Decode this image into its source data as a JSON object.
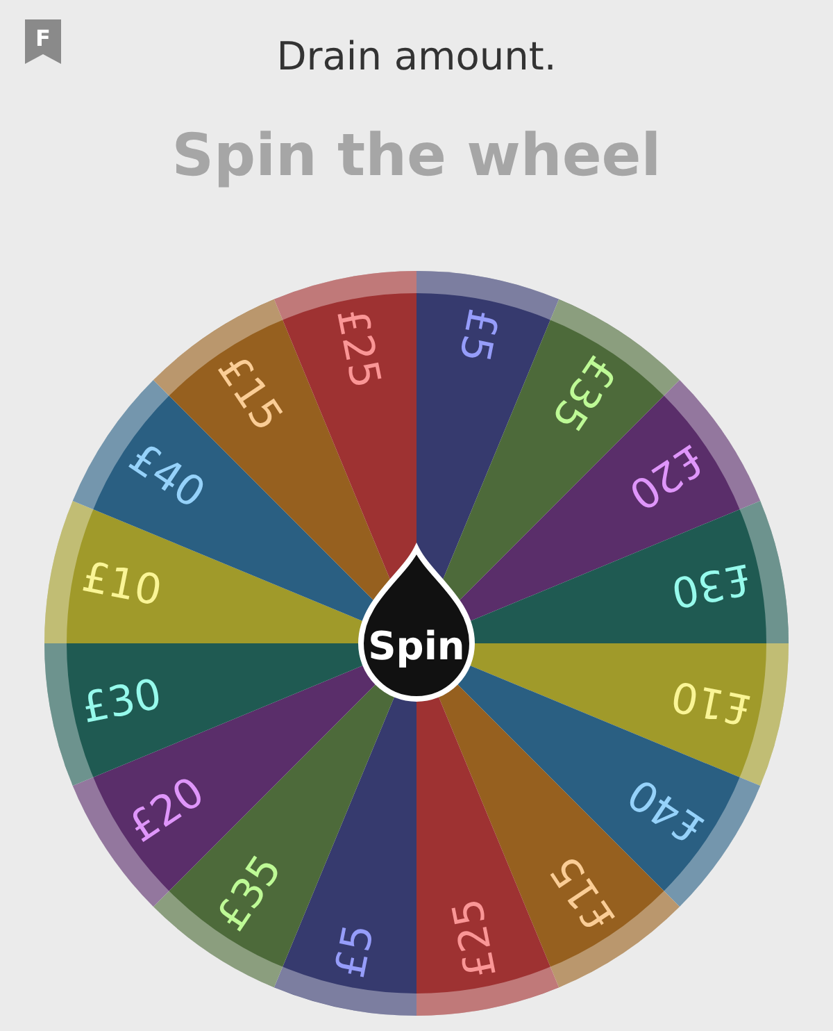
{
  "header": {
    "badge": "F",
    "title": "Drain amount.",
    "heading": "Spin the wheel"
  },
  "wheel": {
    "button": "Spin",
    "segments": [
      {
        "label": "£5",
        "color": "#363a6e"
      },
      {
        "label": "£35",
        "color": "#4d6a3a"
      },
      {
        "label": "£20",
        "color": "#5a2e6a"
      },
      {
        "label": "£30",
        "color": "#1f5a52"
      },
      {
        "label": "£10",
        "color": "#a09a2a"
      },
      {
        "label": "£40",
        "color": "#2a5f82"
      },
      {
        "label": "£15",
        "color": "#96601f"
      },
      {
        "label": "£25",
        "color": "#9e3232"
      },
      {
        "label": "£5",
        "color": "#363a6e"
      },
      {
        "label": "£35",
        "color": "#4d6a3a"
      },
      {
        "label": "£20",
        "color": "#5a2e6a"
      },
      {
        "label": "£30",
        "color": "#1f5a52"
      },
      {
        "label": "£10",
        "color": "#a09a2a"
      },
      {
        "label": "£40",
        "color": "#2a5f82"
      },
      {
        "label": "£15",
        "color": "#96601f"
      },
      {
        "label": "£25",
        "color": "#9e3232"
      }
    ]
  }
}
